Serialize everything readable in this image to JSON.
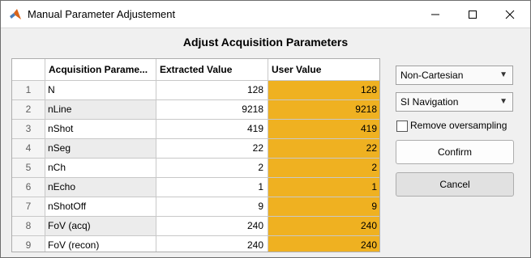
{
  "window": {
    "title": "Manual Parameter Adjustement",
    "icons": {
      "app": "matlab-logo-icon",
      "minimize": "minimize-icon",
      "maximize": "maximize-icon",
      "close": "close-icon"
    }
  },
  "heading": "Adjust Acquisition Parameters",
  "table": {
    "columns": [
      "Acquisition Parame...",
      "Extracted Value",
      "User Value"
    ],
    "rows": [
      {
        "index": "1",
        "param": "N",
        "extracted": "128",
        "user": "128"
      },
      {
        "index": "2",
        "param": "nLine",
        "extracted": "9218",
        "user": "9218"
      },
      {
        "index": "3",
        "param": "nShot",
        "extracted": "419",
        "user": "419"
      },
      {
        "index": "4",
        "param": "nSeg",
        "extracted": "22",
        "user": "22"
      },
      {
        "index": "5",
        "param": "nCh",
        "extracted": "2",
        "user": "2"
      },
      {
        "index": "6",
        "param": "nEcho",
        "extracted": "1",
        "user": "1"
      },
      {
        "index": "7",
        "param": "nShotOff",
        "extracted": "9",
        "user": "9"
      },
      {
        "index": "8",
        "param": "FoV (acq)",
        "extracted": "240",
        "user": "240"
      },
      {
        "index": "9",
        "param": "FoV (recon)",
        "extracted": "240",
        "user": "240"
      }
    ],
    "user_value_color": "#efb121"
  },
  "controls": {
    "trajectory_dropdown": {
      "value": "Non-Cartesian",
      "icon": "caret-down-icon"
    },
    "navigation_dropdown": {
      "value": "SI Navigation",
      "icon": "caret-down-icon"
    },
    "remove_oversampling": {
      "label": "Remove oversampling",
      "checked": false
    },
    "confirm_label": "Confirm",
    "cancel_label": "Cancel"
  }
}
